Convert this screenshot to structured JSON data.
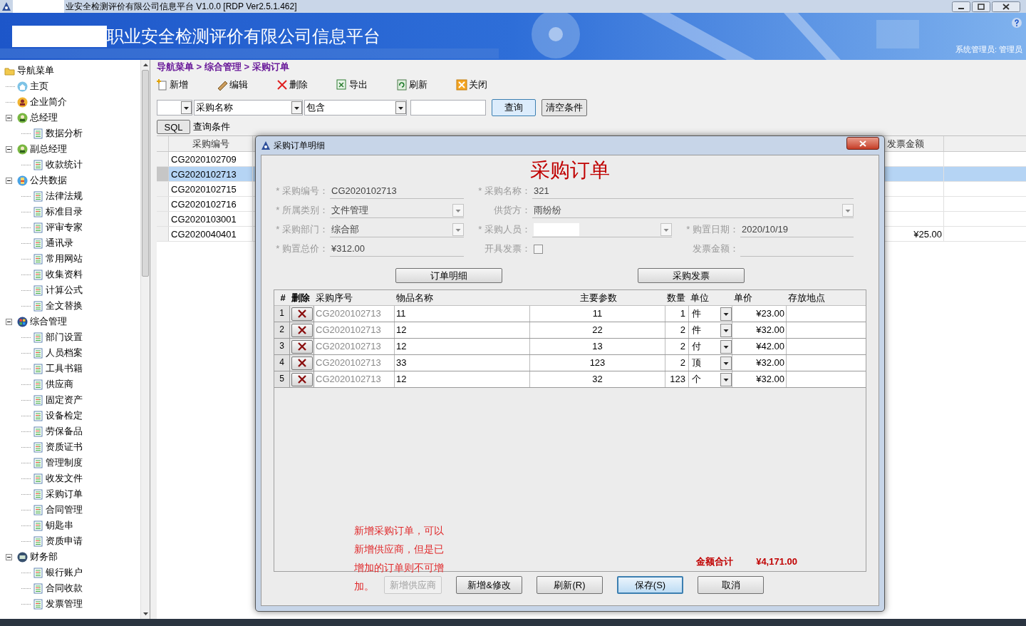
{
  "window": {
    "title": "业安全检测评价有限公司信息平台 V1.0.0 [RDP Ver2.5.1.462]"
  },
  "banner": {
    "title": "职业安全检测评价有限公司信息平台",
    "user": "系统管理员: 管理员"
  },
  "sidebar": {
    "items": [
      {
        "label": "导航菜单",
        "kind": "folder",
        "children": [
          {
            "label": "主页",
            "kind": "home"
          },
          {
            "label": "企业简介",
            "kind": "person"
          },
          {
            "label": "总经理",
            "kind": "manager",
            "expanded": true,
            "children": [
              {
                "label": "数据分析",
                "kind": "page"
              }
            ]
          },
          {
            "label": "副总经理",
            "kind": "manager",
            "expanded": true,
            "children": [
              {
                "label": "收款统计",
                "kind": "page"
              }
            ]
          },
          {
            "label": "公共数据",
            "kind": "data",
            "expanded": true,
            "children": [
              {
                "label": "法律法规",
                "kind": "page"
              },
              {
                "label": "标准目录",
                "kind": "page"
              },
              {
                "label": "评审专家",
                "kind": "page"
              },
              {
                "label": "通讯录",
                "kind": "page"
              },
              {
                "label": "常用网站",
                "kind": "page"
              },
              {
                "label": "收集资料",
                "kind": "page"
              },
              {
                "label": "计算公式",
                "kind": "page"
              },
              {
                "label": "全文替换",
                "kind": "page"
              }
            ]
          },
          {
            "label": "综合管理",
            "kind": "admin",
            "expanded": true,
            "children": [
              {
                "label": "部门设置",
                "kind": "page"
              },
              {
                "label": "人员档案",
                "kind": "page"
              },
              {
                "label": "工具书籍",
                "kind": "page"
              },
              {
                "label": "供应商",
                "kind": "page"
              },
              {
                "label": "固定资产",
                "kind": "page"
              },
              {
                "label": "设备检定",
                "kind": "page"
              },
              {
                "label": "劳保备品",
                "kind": "page"
              },
              {
                "label": "资质证书",
                "kind": "page"
              },
              {
                "label": "管理制度",
                "kind": "page"
              },
              {
                "label": "收发文件",
                "kind": "page"
              },
              {
                "label": "采购订单",
                "kind": "page"
              },
              {
                "label": "合同管理",
                "kind": "page"
              },
              {
                "label": "钥匙串",
                "kind": "page"
              },
              {
                "label": "资质申请",
                "kind": "page"
              }
            ]
          },
          {
            "label": "财务部",
            "kind": "finance",
            "expanded": true,
            "children": [
              {
                "label": "银行账户",
                "kind": "page"
              },
              {
                "label": "合同收款",
                "kind": "page"
              },
              {
                "label": "发票管理",
                "kind": "page"
              }
            ]
          }
        ]
      }
    ]
  },
  "breadcrumb": "导航菜单 > 综合管理 > 采购订单",
  "toolbar": [
    {
      "label": "新增",
      "kind": "add"
    },
    {
      "label": "编辑",
      "kind": "edit"
    },
    {
      "label": "删除",
      "kind": "delete"
    },
    {
      "label": "导出",
      "kind": "export"
    },
    {
      "label": "刷新",
      "kind": "refresh"
    },
    {
      "label": "关闭",
      "kind": "close"
    }
  ],
  "filter": {
    "field": "采购名称",
    "operator": "包含",
    "buttons": [
      "查询",
      "清空条件"
    ]
  },
  "sql": {
    "button": "SQL",
    "label": "查询条件"
  },
  "table": {
    "columns": [
      "采购编号",
      "发票金额"
    ],
    "rows": [
      {
        "code": "CG2020102709",
        "invoice_amount": "",
        "selected": false
      },
      {
        "code": "CG2020102713",
        "invoice_amount": "",
        "selected": true
      },
      {
        "code": "CG2020102715",
        "invoice_amount": "",
        "selected": false
      },
      {
        "code": "CG2020102716",
        "invoice_amount": "",
        "selected": false
      },
      {
        "code": "CG2020103001",
        "invoice_amount": "",
        "selected": false
      },
      {
        "code": "CG2020040401",
        "invoice_amount": "¥25.00",
        "selected": false
      }
    ]
  },
  "dialog": {
    "title": "采购订单明细",
    "heading": "采购订单",
    "form_rows": [
      [
        {
          "label": "* 采购编号：",
          "value": "CG2020102713",
          "kind": "text"
        },
        {
          "label": "* 采购名称：",
          "value": "321",
          "kind": "text"
        }
      ],
      [
        {
          "label": "* 所属类别：",
          "value": "文件管理",
          "kind": "select"
        },
        {
          "label": "供货方：",
          "value": "雨纷纷",
          "kind": "select"
        }
      ],
      [
        {
          "label": "* 采购部门：",
          "value": "综合部",
          "kind": "select"
        },
        {
          "label": "* 采购人员：",
          "kind": "select",
          "redacted": true
        },
        {
          "label": "* 购置日期：",
          "value": "2020/10/19",
          "kind": "text"
        }
      ],
      [
        {
          "label": "* 购置总价：",
          "value": "¥312.00",
          "kind": "text"
        },
        {
          "label": "开具发票：",
          "kind": "checkbox",
          "checked": false
        },
        {
          "label": "发票金额：",
          "kind": "text"
        }
      ]
    ],
    "section_buttons": [
      "订单明细",
      "采购发票"
    ],
    "grid": {
      "columns": [
        "#",
        "删除",
        "采购序号",
        "物品名称",
        "主要参数",
        "数量",
        "单位",
        "单价",
        "存放地点"
      ],
      "rows": [
        {
          "index": "1",
          "code": "CG2020102713",
          "name": "11",
          "param": "11",
          "qty": "1",
          "unit": "件",
          "price": "¥23.00"
        },
        {
          "index": "2",
          "code": "CG2020102713",
          "name": "12",
          "param": "22",
          "qty": "2",
          "unit": "件",
          "price": "¥32.00"
        },
        {
          "index": "3",
          "code": "CG2020102713",
          "name": "12",
          "param": "13",
          "qty": "2",
          "unit": "付",
          "price": "¥42.00"
        },
        {
          "index": "4",
          "code": "CG2020102713",
          "name": "33",
          "param": "123",
          "qty": "2",
          "unit": "顶",
          "price": "¥32.00"
        },
        {
          "index": "5",
          "code": "CG2020102713",
          "name": "12",
          "param": "32",
          "qty": "123",
          "unit": "个",
          "price": "¥32.00"
        }
      ]
    },
    "note_lines": [
      "新增采购订单，可以",
      "新增供应商，但是已",
      "增加的订单则不可增",
      "加。"
    ],
    "total_label": "金额合计",
    "total_value": "¥4,171.00",
    "buttons": [
      {
        "label": "新增供应商",
        "disabled": true,
        "default": false
      },
      {
        "label": "新增&修改",
        "disabled": false,
        "default": false
      },
      {
        "label": "刷新(R)",
        "disabled": false,
        "default": false
      },
      {
        "label": "保存(S)",
        "disabled": false,
        "default": true
      },
      {
        "label": "取消",
        "disabled": false,
        "default": false
      }
    ]
  }
}
